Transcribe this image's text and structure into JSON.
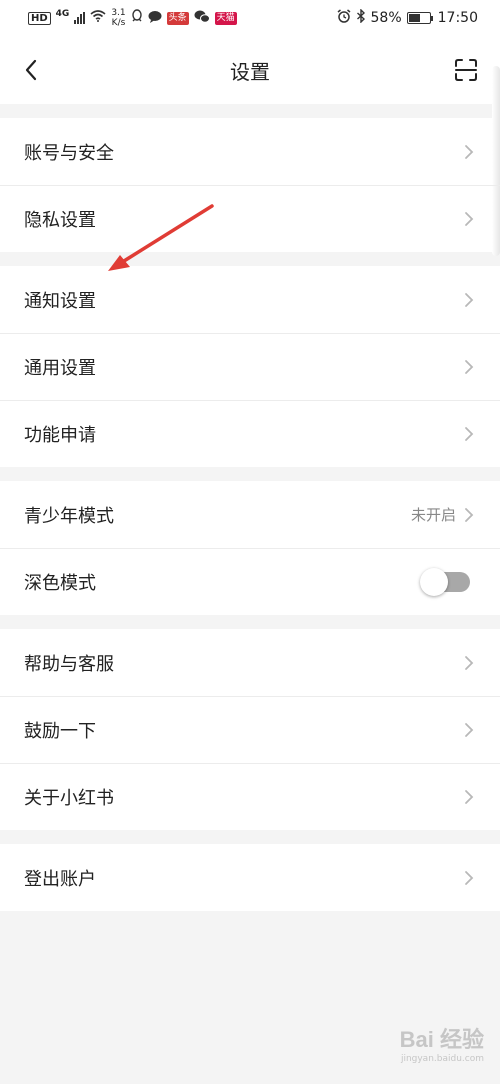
{
  "status_bar": {
    "hd": "HD",
    "network": "4G",
    "speed_top": "3.1",
    "speed_bottom": "K/s",
    "badge1": "头条",
    "badge2": "天猫",
    "battery": "58%",
    "time": "17:50"
  },
  "nav": {
    "title": "设置"
  },
  "groups": [
    {
      "items": [
        {
          "label": "账号与安全"
        },
        {
          "label": "隐私设置"
        }
      ]
    },
    {
      "items": [
        {
          "label": "通知设置"
        },
        {
          "label": "通用设置"
        },
        {
          "label": "功能申请"
        }
      ]
    },
    {
      "items": [
        {
          "label": "青少年模式",
          "value": "未开启"
        },
        {
          "label": "深色模式",
          "toggle": false
        }
      ]
    },
    {
      "items": [
        {
          "label": "帮助与客服"
        },
        {
          "label": "鼓励一下"
        },
        {
          "label": "关于小红书"
        }
      ]
    },
    {
      "items": [
        {
          "label": "登出账户"
        }
      ]
    }
  ],
  "annotation": {
    "arrow_color": "#e03c35"
  },
  "watermark": {
    "logo": "Bai 经验",
    "url": "jingyan.baidu.com"
  }
}
